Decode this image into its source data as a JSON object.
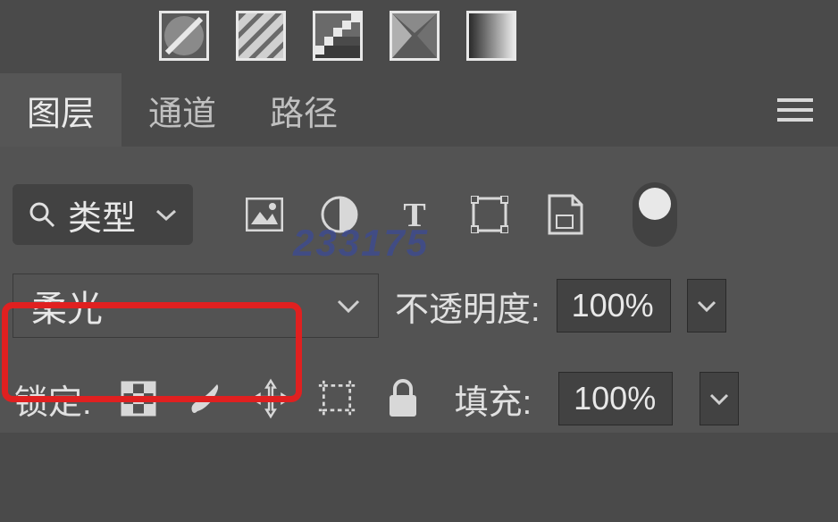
{
  "toolbar": {
    "icons": [
      "denied",
      "stripes",
      "pixel-stair",
      "envelope",
      "gradient"
    ]
  },
  "tabs": {
    "items": [
      {
        "label": "图层",
        "active": true
      },
      {
        "label": "通道",
        "active": false
      },
      {
        "label": "路径",
        "active": false
      }
    ]
  },
  "watermark": "233175",
  "filter": {
    "type_label": "类型",
    "icons": [
      "image",
      "adjustment",
      "text",
      "shape",
      "smartobject"
    ]
  },
  "blend": {
    "mode": "柔光",
    "opacity_label": "不透明度:",
    "opacity_value": "100%"
  },
  "lock": {
    "label": "锁定:",
    "fill_label": "填充:",
    "fill_value": "100%"
  }
}
